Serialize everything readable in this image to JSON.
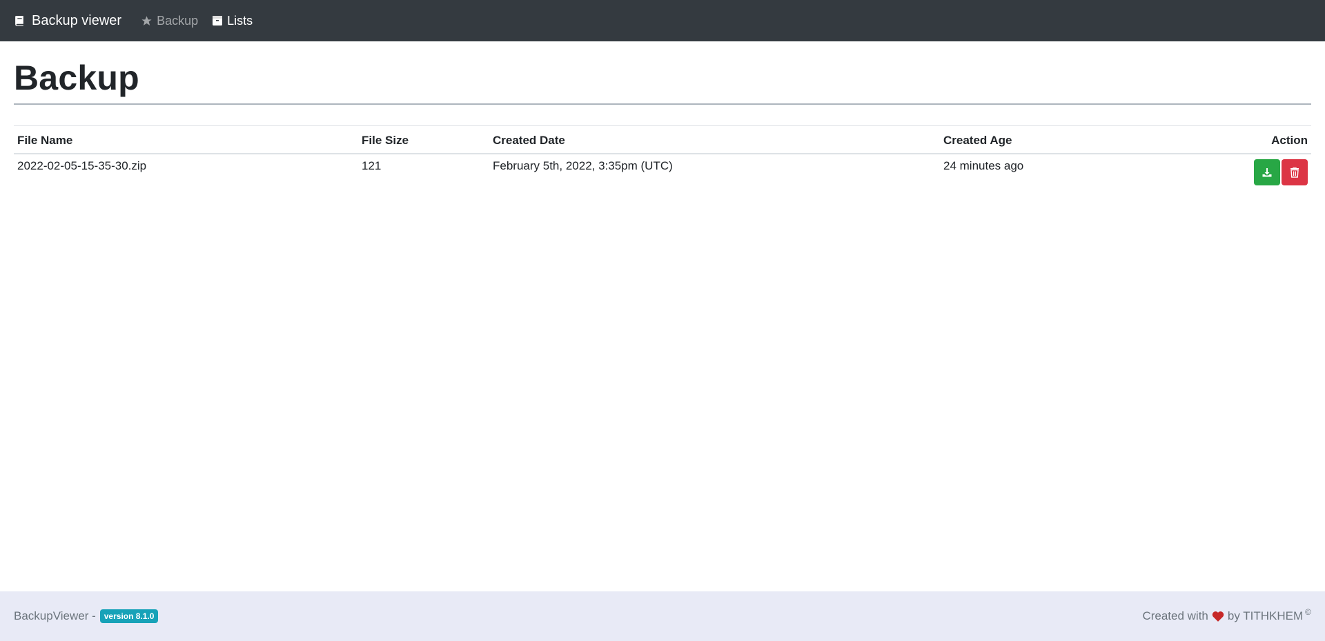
{
  "navbar": {
    "brand": "Backup viewer",
    "links": [
      {
        "label": "Backup",
        "icon": "star-icon",
        "active": false
      },
      {
        "label": "Lists",
        "icon": "archive-icon",
        "active": true
      }
    ]
  },
  "page": {
    "title": "Backup"
  },
  "table": {
    "headers": {
      "file_name": "File Name",
      "file_size": "File Size",
      "created_date": "Created Date",
      "created_age": "Created Age",
      "action": "Action"
    },
    "rows": [
      {
        "file_name": "2022-02-05-15-35-30.zip",
        "file_size": "121",
        "created_date": "February 5th, 2022, 3:35pm (UTC)",
        "created_age": "24 minutes ago"
      }
    ]
  },
  "footer": {
    "app_name": "BackupViewer -",
    "version": "version 8.1.0",
    "created_with": "Created with",
    "by": "by TITHKHEM",
    "copyright": "©"
  },
  "colors": {
    "navbar": "#343a40",
    "success": "#28a745",
    "danger": "#dc3545",
    "badge": "#17a2b8",
    "heart": "#c62828",
    "footer_bg": "#e8eaf6"
  }
}
